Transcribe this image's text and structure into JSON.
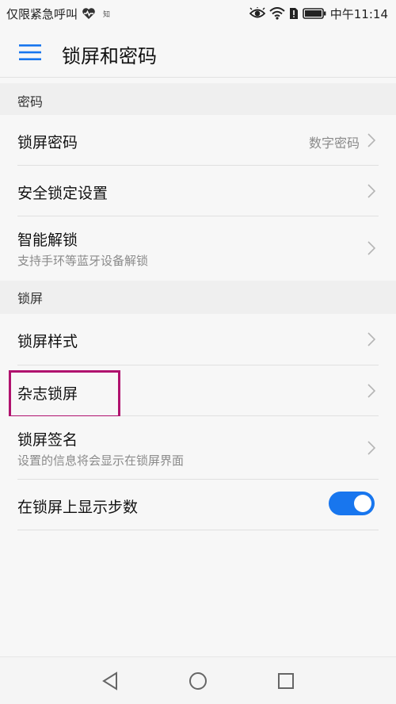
{
  "status_bar": {
    "carrier": "仅限紧急呼叫",
    "small_label": "知",
    "time": "中午11:14"
  },
  "app_bar": {
    "title": "锁屏和密码",
    "menu_icon": "hamburger-menu-icon"
  },
  "sections": {
    "password_header": "密码",
    "lockscreen_header": "锁屏"
  },
  "rows": {
    "lock_password": {
      "title": "锁屏密码",
      "value": "数字密码"
    },
    "security_lock": {
      "title": "安全锁定设置"
    },
    "smart_unlock": {
      "title": "智能解锁",
      "subtitle": "支持手环等蓝牙设备解锁"
    },
    "lock_style": {
      "title": "锁屏样式"
    },
    "magazine_lock": {
      "title": "杂志锁屏"
    },
    "lock_signature": {
      "title": "锁屏签名",
      "subtitle": "设置的信息将会显示在锁屏界面"
    },
    "show_steps": {
      "title": "在锁屏上显示步数",
      "toggle_on": true
    }
  },
  "colors": {
    "accent": "#1876ee",
    "highlight": "#b0126e"
  }
}
